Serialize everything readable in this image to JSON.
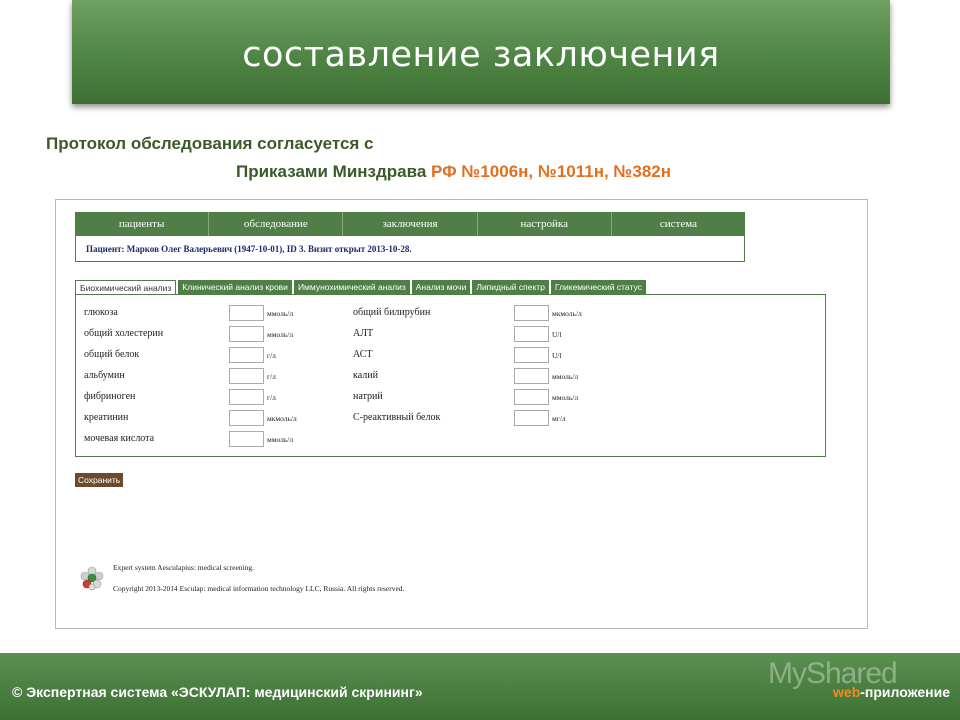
{
  "slide": {
    "title": "составление заключения",
    "protocol_line1": "Протокол обследования согласуется с",
    "protocol_line2_prefix": "Приказами Минздрава ",
    "protocol_line2_orders": "РФ №1006н, №1011н, №382н"
  },
  "app": {
    "nav": [
      "пациенты",
      "обследование",
      "заключения",
      "настройка",
      "система"
    ],
    "patient_info": "Пациент: Марков Олег Валерьевич (1947-10-01), ID 3. Визит открыт 2013-10-28.",
    "tabs": [
      {
        "label": "Биохимический анализ",
        "active": true
      },
      {
        "label": "Клинический анализ крови",
        "active": false
      },
      {
        "label": "Иммунохимический анализ",
        "active": false
      },
      {
        "label": "Анализ мочи",
        "active": false
      },
      {
        "label": "Липидный спектр",
        "active": false
      },
      {
        "label": "Гликемический статус",
        "active": false
      }
    ],
    "left_fields": [
      {
        "label": "глюкоза",
        "unit": "ммоль/л",
        "value": ""
      },
      {
        "label": "общий холестерин",
        "unit": "ммоль/л",
        "value": ""
      },
      {
        "label": "общий белок",
        "unit": "г/л",
        "value": ""
      },
      {
        "label": "альбумин",
        "unit": "г/л",
        "value": ""
      },
      {
        "label": "фибриноген",
        "unit": "г/л",
        "value": ""
      },
      {
        "label": "креатинин",
        "unit": "мкмоль/л",
        "value": ""
      },
      {
        "label": "мочевая кислота",
        "unit": "ммоль/л",
        "value": ""
      }
    ],
    "right_fields": [
      {
        "label": "общий билирубин",
        "unit": "мкмоль/л",
        "value": ""
      },
      {
        "label": "АЛТ",
        "unit": "U/l",
        "value": ""
      },
      {
        "label": "АСТ",
        "unit": "U/l",
        "value": ""
      },
      {
        "label": "калий",
        "unit": "ммоль/л",
        "value": ""
      },
      {
        "label": "натрий",
        "unit": "ммоль/л",
        "value": ""
      },
      {
        "label": "С-реактивный белок",
        "unit": "мг/л",
        "value": ""
      }
    ],
    "save_label": "Сохранить",
    "footer_line1": "Expert system Aesculapius: medical screening.",
    "footer_line2": "Copyright 2013-2014 Esculap: medical information technology LLC, Russia. All rights reserved.",
    "logo_icon": "molecule-icon"
  },
  "bottom_bar": {
    "left_text": "© Экспертная система «ЭСКУЛАП: медицинский скрининг»",
    "right_web": "web",
    "right_suffix": "-приложение",
    "watermark": "MyShared"
  },
  "colors": {
    "banner_green": "#4f8544",
    "nav_green": "#4f7f47",
    "orders_orange": "#e07020",
    "save_brown": "#6b4b2b"
  }
}
